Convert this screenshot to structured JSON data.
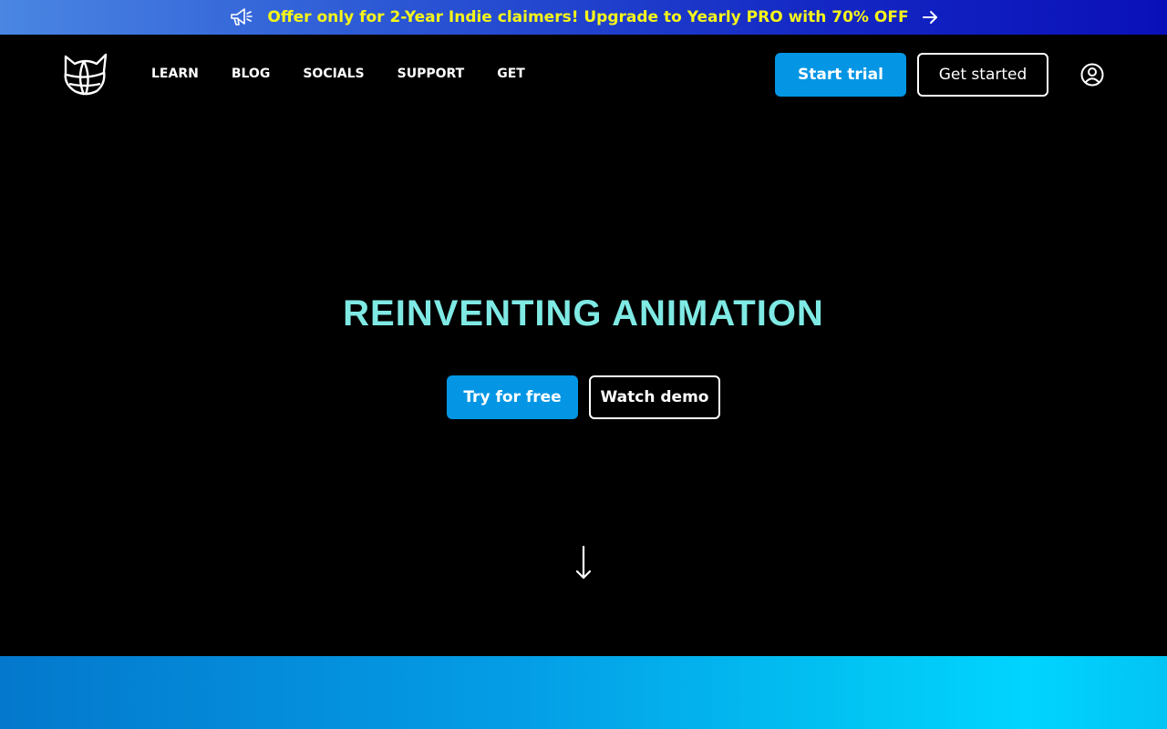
{
  "promo": {
    "text": "Offer only for 2-Year Indie claimers! Upgrade to Yearly PRO with 70% OFF",
    "icon_left": "megaphone-icon",
    "icon_right": "arrow-right-icon",
    "text_color": "#f5f51a"
  },
  "nav": {
    "logo": "cat-globe-logo",
    "items": [
      {
        "label": "LEARN"
      },
      {
        "label": "BLOG"
      },
      {
        "label": "SOCIALS"
      },
      {
        "label": "SUPPORT"
      },
      {
        "label": "GET"
      }
    ],
    "start_trial": "Start trial",
    "get_started": "Get started",
    "account_icon": "user-circle-icon"
  },
  "hero": {
    "title": "REINVENTING ANIMATION",
    "title_color": "#7fe9e4",
    "try_free": "Try for free",
    "watch_demo": "Watch demo",
    "scroll_icon": "arrow-down-icon"
  },
  "colors": {
    "accent": "#0496e4",
    "background": "#000000"
  }
}
